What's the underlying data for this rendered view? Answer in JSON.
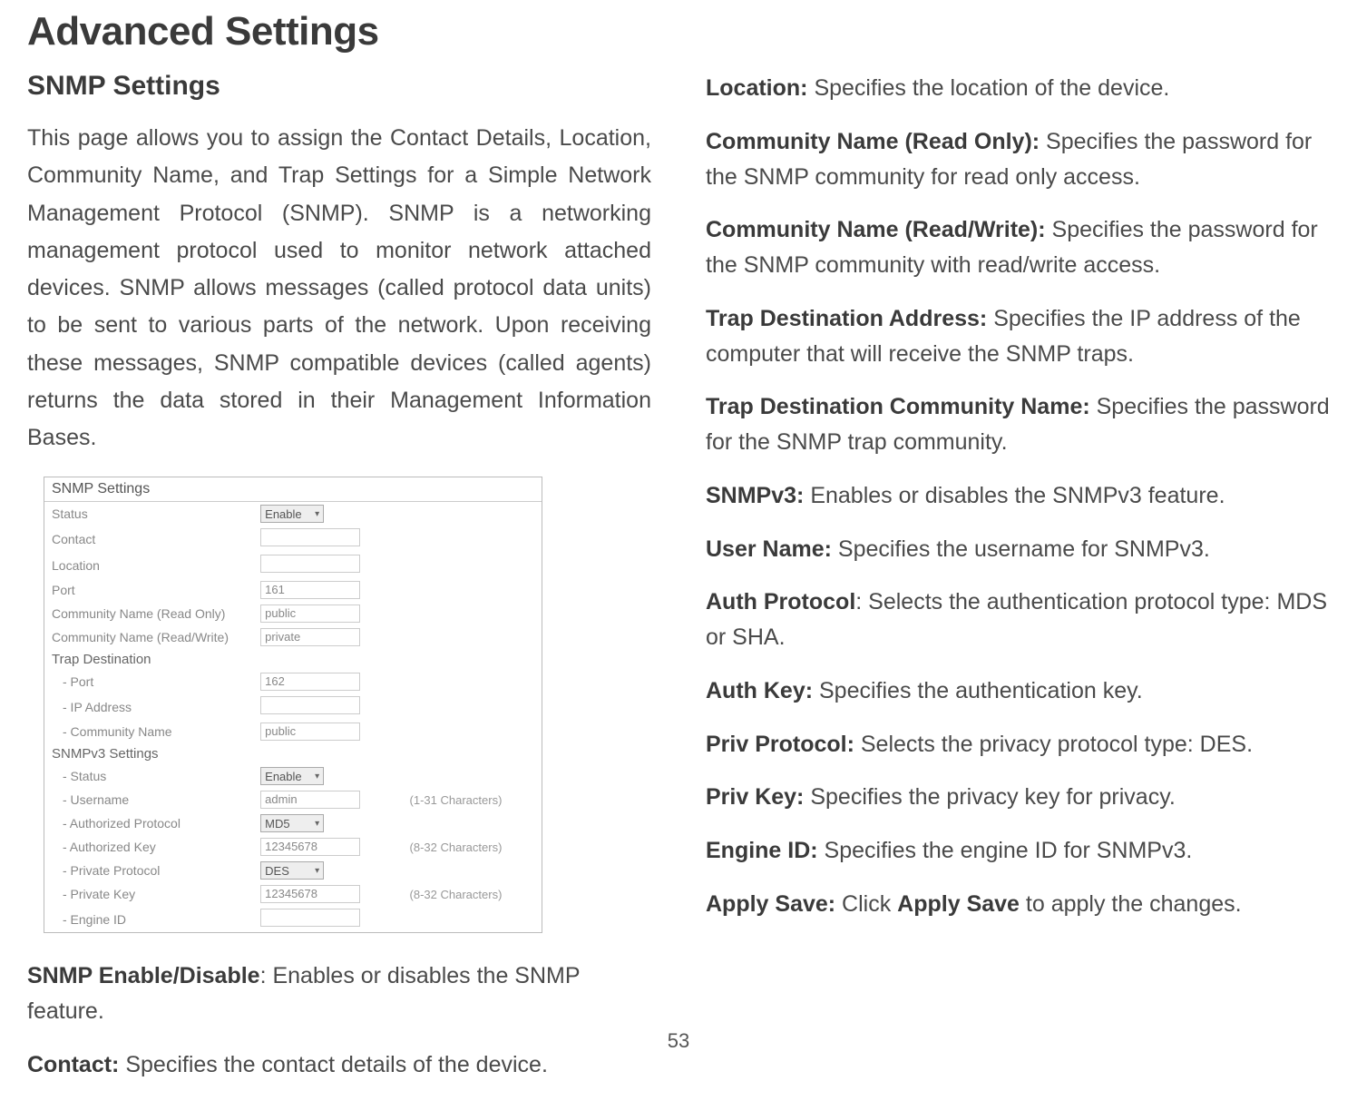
{
  "page_title": "Advanced Settings",
  "section_title": "SNMP Settings",
  "intro": "This page allows you to assign the Contact Details, Location, Community Name, and Trap Settings for a Simple Network Management Protocol (SNMP). SNMP is a networking management protocol used to monitor network attached devices. SNMP allows messages (called protocol data units) to be sent to various parts of the network. Upon receiving these messages, SNMP compatible devices (called agents) returns the data stored in their Management Information Bases.",
  "screenshot": {
    "title": "SNMP Settings",
    "status_label": "Status",
    "status_value": "Enable",
    "contact_label": "Contact",
    "location_label": "Location",
    "port_label": "Port",
    "port_value": "161",
    "cn_ro_label": "Community Name (Read Only)",
    "cn_ro_value": "public",
    "cn_rw_label": "Community Name (Read/Write)",
    "cn_rw_value": "private",
    "trap_header": "Trap Destination",
    "trap_port_label": "- Port",
    "trap_port_value": "162",
    "trap_ip_label": "- IP Address",
    "trap_cn_label": "- Community Name",
    "trap_cn_value": "public",
    "v3_header": "SNMPv3 Settings",
    "v3_status_label": "- Status",
    "v3_status_value": "Enable",
    "v3_user_label": "- Username",
    "v3_user_value": "admin",
    "v3_user_hint": "(1-31 Characters)",
    "v3_authp_label": "- Authorized Protocol",
    "v3_authp_value": "MD5",
    "v3_authk_label": "- Authorized Key",
    "v3_authk_value": "12345678",
    "v3_authk_hint": "(8-32 Characters)",
    "v3_privp_label": "- Private Protocol",
    "v3_privp_value": "DES",
    "v3_privk_label": "- Private Key",
    "v3_privk_value": "12345678",
    "v3_privk_hint": "(8-32 Characters)",
    "v3_engine_label": "- Engine ID"
  },
  "defs_left": [
    {
      "term": "SNMP Enable/Disable",
      "colon_outside": true,
      "desc": ": Enables or disables the SNMP feature."
    },
    {
      "term": "Contact:",
      "desc": " Specifies the contact details of the device."
    }
  ],
  "defs_right": [
    {
      "term": "Location:",
      "desc": " Specifies the location of the device."
    },
    {
      "term": "Community Name (Read Only):",
      "desc": " Specifies the password for the SNMP community for read only access."
    },
    {
      "term": "Community Name (Read/Write):",
      "desc": " Specifies the password for the SNMP community with read/write access."
    },
    {
      "term": "Trap Destination Address:",
      "desc": " Specifies the IP address of the computer that will receive the SNMP traps."
    },
    {
      "term": "Trap Destination Community Name:",
      "desc": " Specifies the password for the SNMP trap community."
    },
    {
      "term": "SNMPv3:",
      "desc": " Enables or disables the SNMPv3 feature."
    },
    {
      "term": "User Name:",
      "desc": " Specifies the username for SNMPv3."
    },
    {
      "term": "Auth Protocol",
      "colon_outside": true,
      "desc": ": Selects the authentication protocol type: MDS or SHA."
    },
    {
      "term": "Auth Key:",
      "desc": " Specifies the authentication key."
    },
    {
      "term": "Priv Protocol:",
      "desc": " Selects the privacy protocol type: DES."
    },
    {
      "term": "Priv Key:",
      "desc": " Specifies the privacy key for privacy."
    },
    {
      "term": "Engine ID:",
      "desc": " Specifies the engine ID for SNMPv3."
    },
    {
      "term": "Apply Save:",
      "desc_pre": " Click ",
      "bold_mid": "Apply Save",
      "desc_post": " to apply the changes."
    }
  ],
  "page_number": "53"
}
